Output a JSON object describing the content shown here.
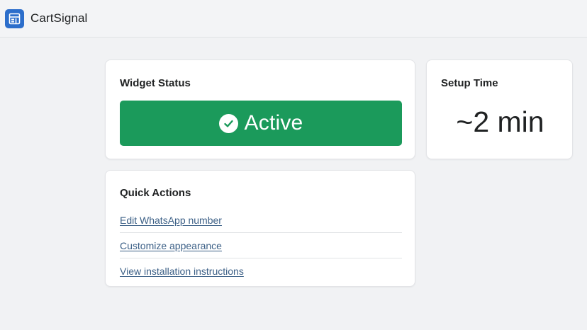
{
  "header": {
    "app_name": "CartSignal",
    "logo_icon": "store-layout-icon",
    "logo_color": "#2c6ecb"
  },
  "widget_status": {
    "title": "Widget Status",
    "status_label": "Active",
    "status_icon": "check-circle-icon",
    "status_color": "#1b9a5b"
  },
  "setup_time": {
    "title": "Setup Time",
    "value": "~2 min"
  },
  "quick_actions": {
    "title": "Quick Actions",
    "items": [
      {
        "label": "Edit WhatsApp number"
      },
      {
        "label": "Customize appearance"
      },
      {
        "label": "View installation instructions"
      }
    ]
  }
}
